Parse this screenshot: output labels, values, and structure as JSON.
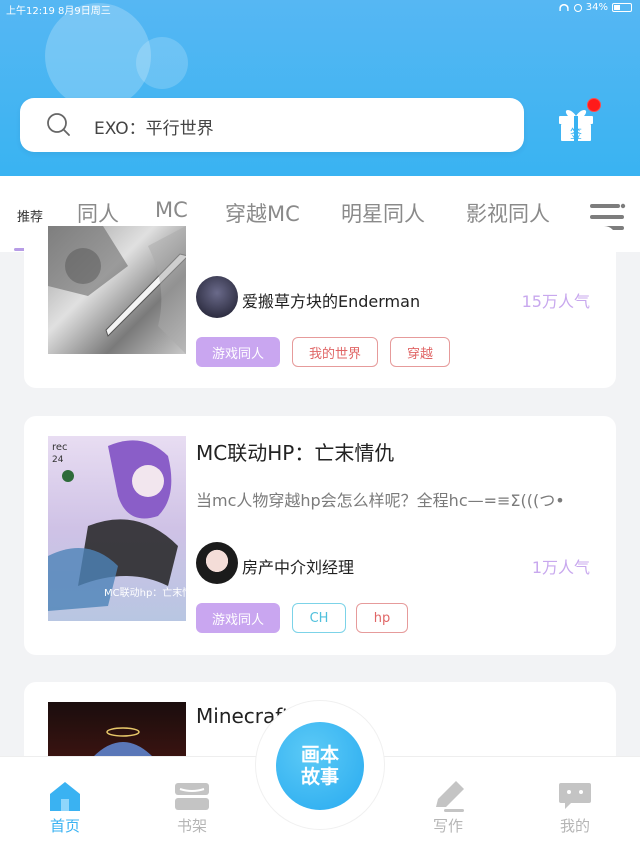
{
  "status_bar": {
    "time": "上午12:19  8月9日周三",
    "battery": "34%"
  },
  "search": {
    "placeholder": "EXO：平行世界"
  },
  "gift": {
    "label": "签"
  },
  "tabs": [
    "推荐",
    "同人",
    "MC",
    "穿越MC",
    "明星同人",
    "影视同人"
  ],
  "cards": [
    {
      "author": "爱搬草方块的Enderman",
      "popularity": "15万人气",
      "tags": [
        "游戏同人",
        "我的世界",
        "穿越"
      ]
    },
    {
      "title": "MC联动HP：亡末情仇",
      "description": "当mc人物穿越hp会怎么样呢？全程hc—=≡Σ(((つ•",
      "author": "房产中介刘经理",
      "popularity": "1万人气",
      "tags": [
        "游戏同人",
        "CH",
        "hp"
      ],
      "cover_text": "MC联动hp：亡末情仇"
    },
    {
      "title": "Minecraft B"
    }
  ],
  "bottom_nav": {
    "home": "首页",
    "shelf": "书架",
    "center": "画本故事",
    "write": "写作",
    "mine": "我的"
  },
  "colors": {
    "header": "#39b3f2",
    "accent_purple": "#c9a6f0",
    "popularity": "#c8a8ee"
  }
}
